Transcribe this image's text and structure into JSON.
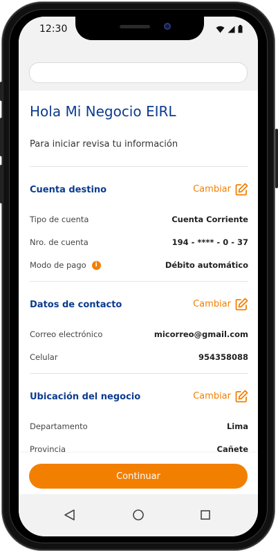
{
  "status_bar": {
    "time": "12:30"
  },
  "header": {
    "greeting": "Hola Mi Negocio EIRL",
    "subtitle": "Para iniciar revisa tu información"
  },
  "sections": [
    {
      "title": "Cuenta destino",
      "action_label": "Cambiar",
      "rows": [
        {
          "label": "Tipo de cuenta",
          "value": "Cuenta Corriente"
        },
        {
          "label": "Nro. de cuenta",
          "value": "194 - **** - 0 - 37"
        },
        {
          "label": "Modo de pago",
          "value": "Débito automático"
        }
      ]
    },
    {
      "title": "Datos de contacto",
      "action_label": "Cambiar",
      "rows": [
        {
          "label": "Correo electrónico",
          "value": "micorreo@gmail.com"
        },
        {
          "label": "Celular",
          "value": "954358088"
        }
      ]
    },
    {
      "title": "Ubicación del negocio",
      "action_label": "Cambiar",
      "rows": [
        {
          "label": "Departamento",
          "value": "Lima"
        },
        {
          "label": "Provincia",
          "value": "Cañete"
        }
      ]
    }
  ],
  "info_icon_glyph": "i",
  "cta": {
    "label": "Continuar"
  },
  "icons": {
    "edit": "edit-icon",
    "info": "info-icon",
    "back": "back-triangle-icon",
    "home": "home-circle-icon",
    "recents": "recents-square-icon"
  },
  "colors": {
    "brand_blue": "#0c3b8f",
    "accent_orange": "#f37f00",
    "chrome_gray": "#f2f2f2"
  }
}
